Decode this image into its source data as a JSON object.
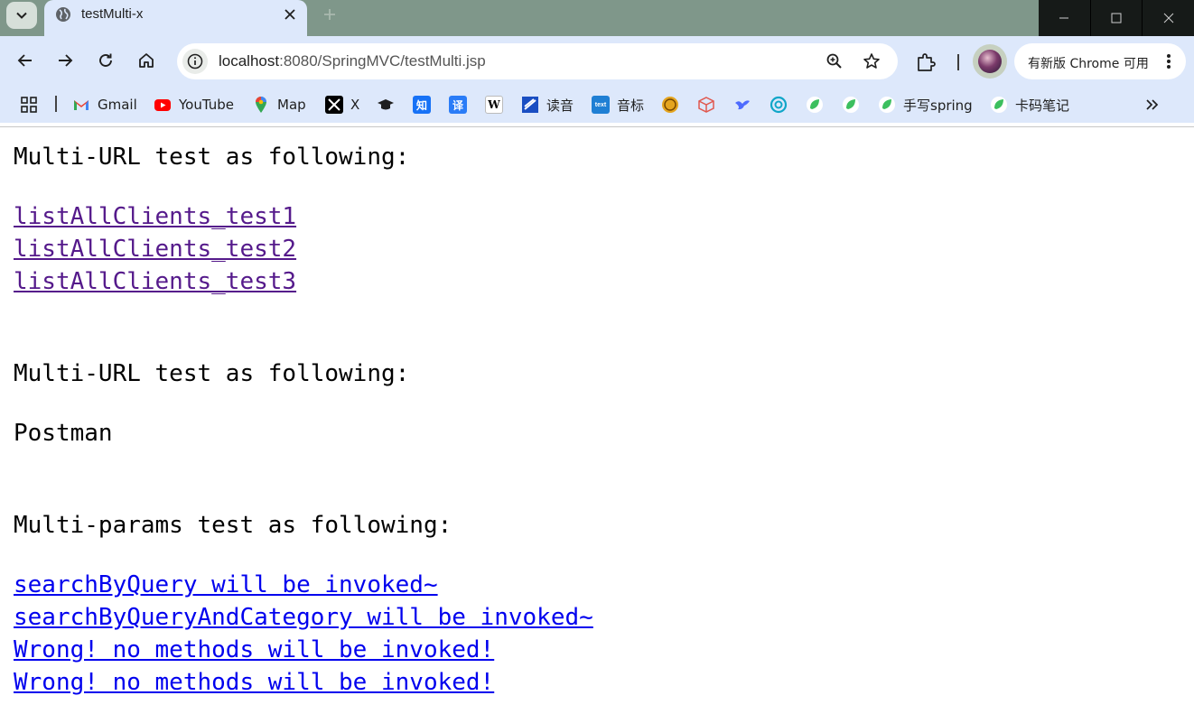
{
  "window": {
    "tab_title": "testMulti-x"
  },
  "toolbar": {
    "url_host": "localhost",
    "url_rest": ":8080/SpringMVC/testMulti.jsp",
    "update_label": "有新版 Chrome 可用"
  },
  "bookmarks": [
    {
      "label": "Gmail",
      "icon": "gmail-icon"
    },
    {
      "label": "YouTube",
      "icon": "youtube-icon"
    },
    {
      "label": "Map",
      "icon": "maps-icon"
    },
    {
      "label": "X",
      "icon": "x-icon"
    },
    {
      "label": "",
      "icon": "graduation-cap-icon"
    },
    {
      "label": "",
      "icon": "zhihu-icon"
    },
    {
      "label": "",
      "icon": "translate-icon"
    },
    {
      "label": "",
      "icon": "wikipedia-icon"
    },
    {
      "label": "读音",
      "icon": "flag-icon"
    },
    {
      "label": "音标",
      "icon": "text-logo-icon"
    },
    {
      "label": "",
      "icon": "coin-icon"
    },
    {
      "label": "",
      "icon": "cube-icon"
    },
    {
      "label": "",
      "icon": "bird-icon"
    },
    {
      "label": "",
      "icon": "swirl-icon"
    },
    {
      "label": "",
      "icon": "leaf-icon"
    },
    {
      "label": "",
      "icon": "leaf-icon"
    },
    {
      "label": "手写spring",
      "icon": "leaf-icon"
    },
    {
      "label": "卡码笔记",
      "icon": "leaf-icon"
    }
  ],
  "content": {
    "heading1": "Multi-URL test as following:",
    "links1": [
      "listAllClients_test1",
      "listAllClients_test2",
      "listAllClients_test3"
    ],
    "heading2": "Multi-URL test as following:",
    "postman": "Postman",
    "heading3": "Multi-params test as following:",
    "links2": [
      "searchByQuery will be invoked~",
      "searchByQueryAndCategory will be invoked~",
      "Wrong! no methods will be invoked!",
      "Wrong! no methods will be invoked!"
    ]
  },
  "colors": {
    "visited_link": "#551a8b",
    "unvisited_link": "#0000ee",
    "toolbar_bg": "#dde8fb",
    "tabstrip_bg": "#7f978a"
  }
}
